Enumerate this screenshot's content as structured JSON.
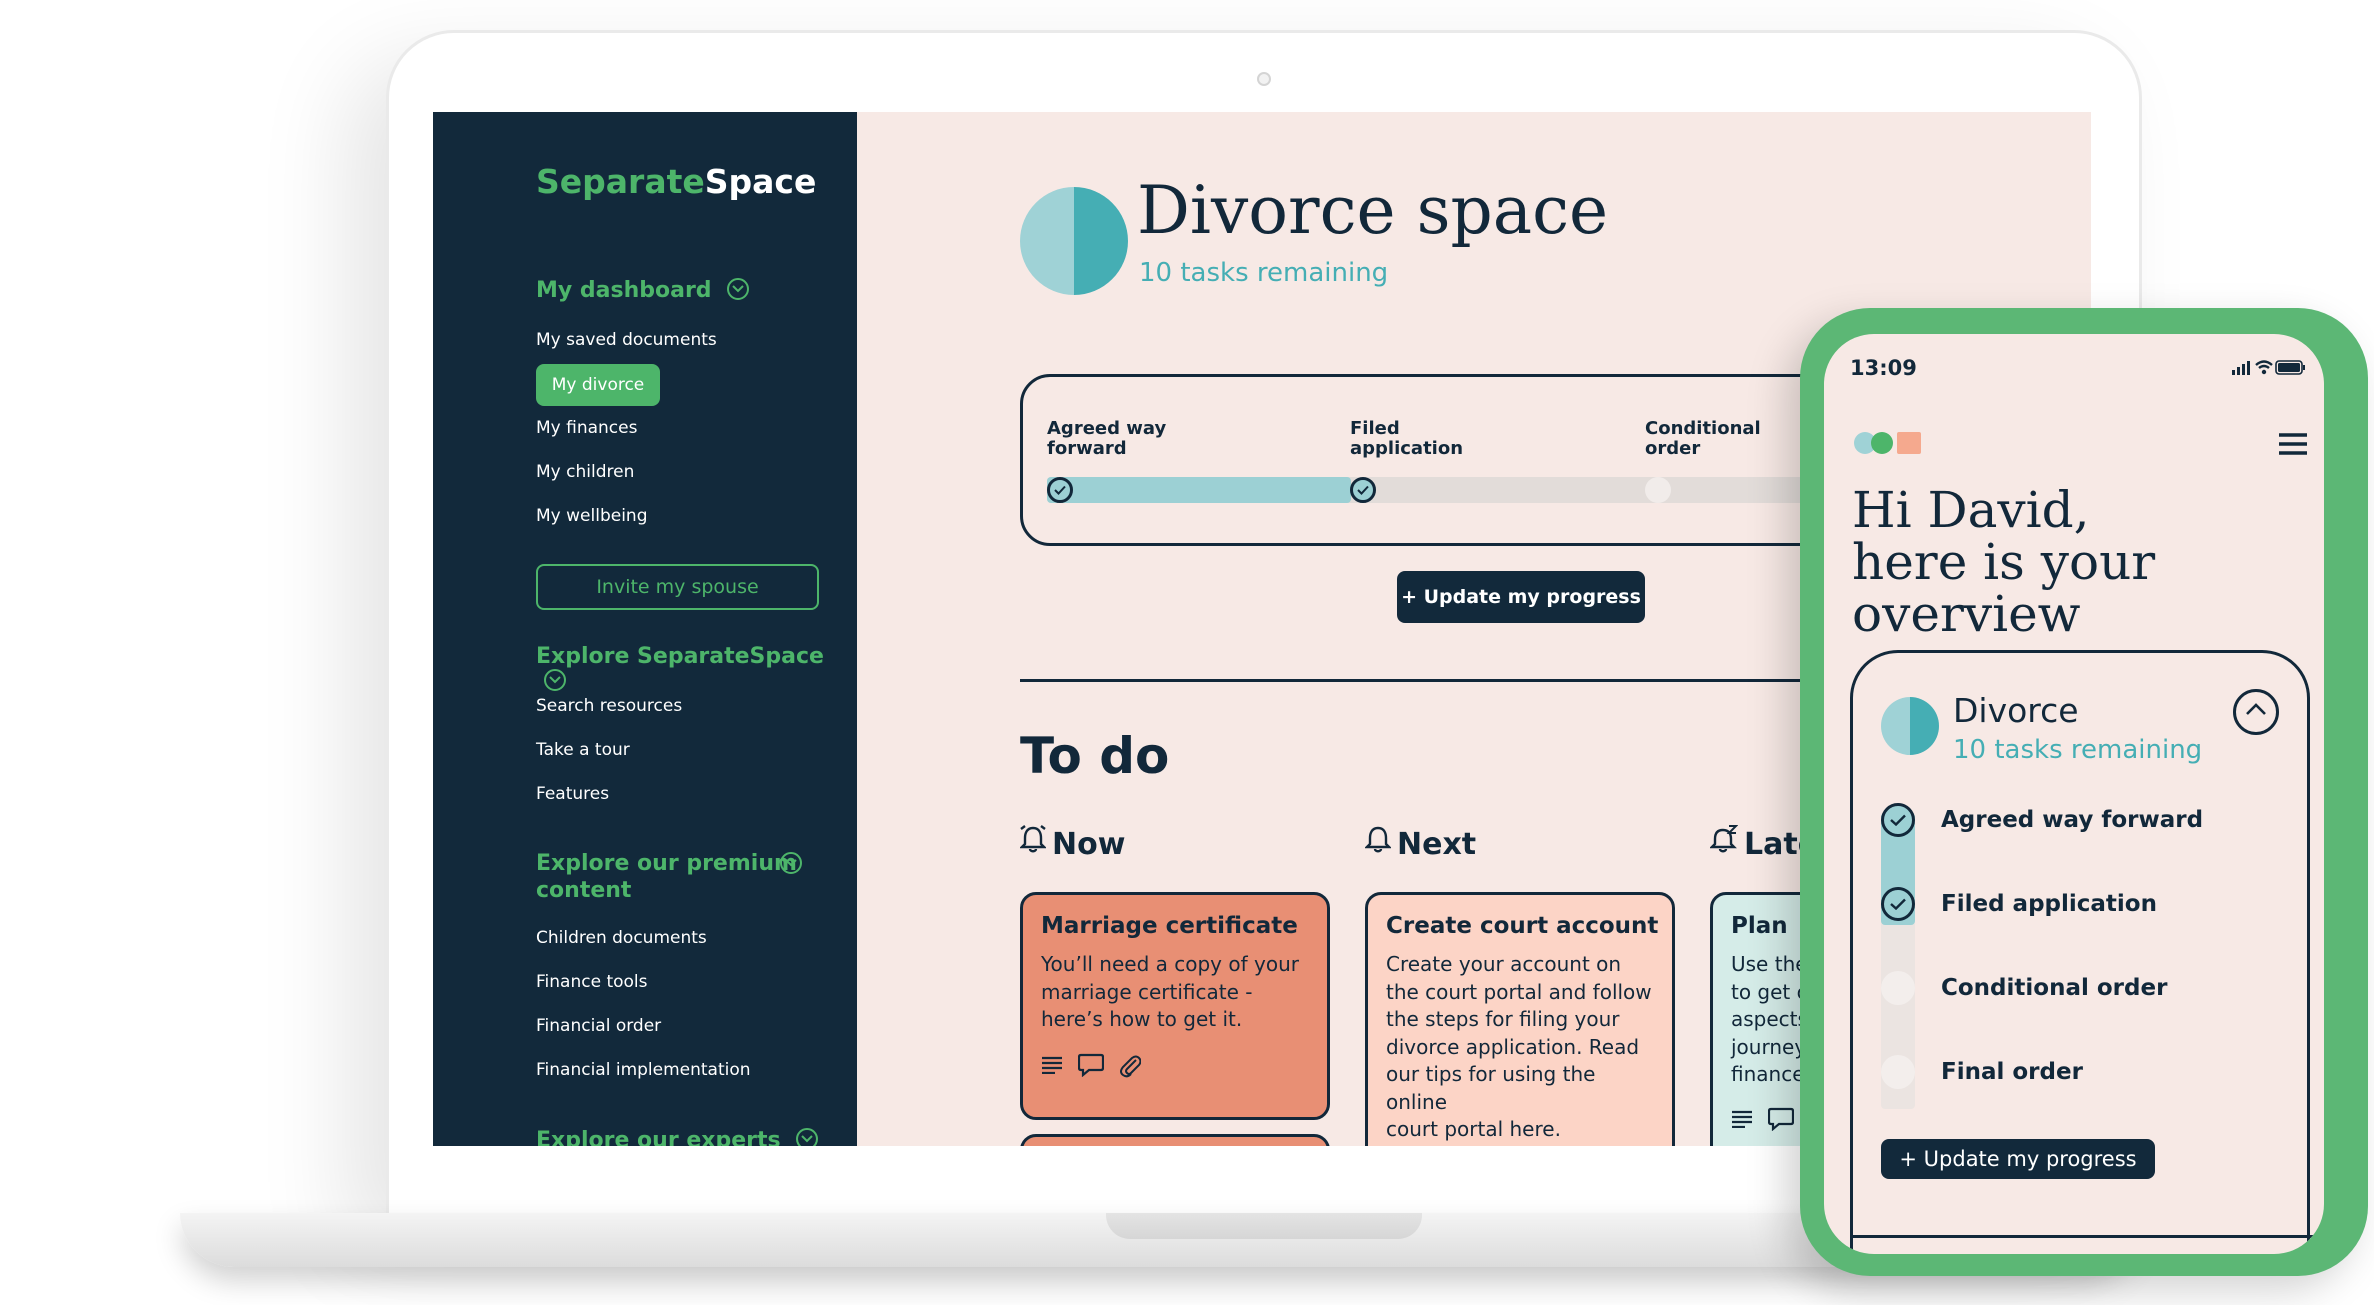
{
  "app": {
    "brand_part1": "Separate",
    "brand_part2": "Space"
  },
  "sidebar": {
    "dashboard_heading": "My dashboard",
    "dashboard_items": [
      "My saved documents",
      "My divorce",
      "My finances",
      "My children",
      "My wellbeing"
    ],
    "active_item": "My divorce",
    "invite_label": "Invite my spouse",
    "explore_heading": "Explore SeparateSpace",
    "explore_items": [
      "Search resources",
      "Take a tour",
      "Features"
    ],
    "premium_heading_line1": "Explore our premium",
    "premium_heading_line2": "content",
    "premium_items": [
      "Children documents",
      "Finance tools",
      "Financial order",
      "Financial implementation"
    ],
    "experts_heading": "Explore our experts"
  },
  "main": {
    "title": "Divorce space",
    "subtitle": "10 tasks remaining",
    "progress": {
      "stages": [
        {
          "line1": "Agreed way",
          "line2": "forward",
          "done": true
        },
        {
          "line1": "Filed",
          "line2": "application",
          "done": true
        },
        {
          "line1": "Conditional",
          "line2": "order",
          "done": false
        }
      ]
    },
    "update_button": "+ Update my progress",
    "todo_title": "To do",
    "columns": [
      {
        "heading": "Now"
      },
      {
        "heading": "Next"
      },
      {
        "heading": "Late"
      }
    ],
    "cards": [
      {
        "title": "Marriage certificate",
        "lines": [
          "You’ll need a copy of your",
          "marriage certificate -",
          "here’s how to get it."
        ],
        "color": "#e88f74"
      },
      {
        "title": "Create court account",
        "lines": [
          "Create your account on",
          "the court portal and follow",
          "the steps for filing your",
          "divorce application.  Read",
          "our tips for using the online",
          "court portal here."
        ],
        "color": "#fcd4c6"
      },
      {
        "title": "Plan",
        "lines": [
          "Use the",
          "to get c",
          "aspects",
          "journey",
          "finance"
        ],
        "color": "#d5ece8"
      }
    ]
  },
  "phone": {
    "time": "13:09",
    "greeting_line1": "Hi David,",
    "greeting_line2": "here is your overview",
    "card_title": "Divorce",
    "card_subtitle": "10 tasks remaining",
    "stages": [
      {
        "label": "Agreed way forward",
        "done": true
      },
      {
        "label": "Filed application",
        "done": true
      },
      {
        "label": "Conditional order",
        "done": false
      },
      {
        "label": "Final order",
        "done": false
      }
    ],
    "update_button": "+ Update my progress"
  },
  "colors": {
    "navy": "#12293b",
    "green": "#4db56a",
    "teal": "#45aeb4",
    "light_teal": "#9cd0d4",
    "blush": "#f7e9e5",
    "salmon": "#e88f74"
  }
}
